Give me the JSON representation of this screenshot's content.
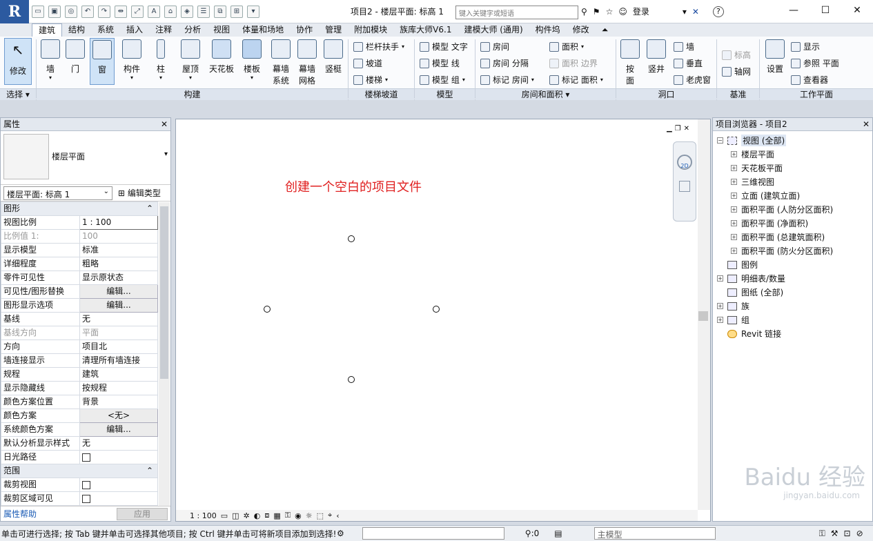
{
  "app": {
    "logo": "R",
    "document_title": "项目2 - 楼层平面: 标高 1"
  },
  "titlebar": {
    "search_placeholder": "键入关键字或短语",
    "login": "登录",
    "help": "?"
  },
  "ribbon_tabs": [
    "建筑",
    "结构",
    "系统",
    "插入",
    "注释",
    "分析",
    "视图",
    "体量和场地",
    "协作",
    "管理",
    "附加模块",
    "族库大师V6.1",
    "建模大师 (通用)",
    "构件坞",
    "修改"
  ],
  "ribbon": {
    "modify": "修改",
    "wall": "墙",
    "door": "门",
    "window": "窗",
    "component": "构件",
    "column": "柱",
    "roof": "屋顶",
    "ceiling": "天花板",
    "floor": "楼板",
    "curtain_system_1": "幕墙",
    "curtain_system_2": "系统",
    "curtain_grid_1": "幕墙",
    "curtain_grid_2": "网格",
    "mullion": "竖梃",
    "railing": "栏杆扶手",
    "ramp": "坡道",
    "stair": "楼梯",
    "model_text": "模型 文字",
    "model_line": "模型 线",
    "model_group": "模型 组",
    "room": "房间",
    "room_sep": "房间 分隔",
    "tag_room": "标记 房间",
    "area": "面积",
    "area_boundary": "面积 边界",
    "tag_area": "标记 面积",
    "by_face_1": "按",
    "by_face_2": "面",
    "shaft": "竖井",
    "wall_opening": "墙",
    "vertical": "垂直",
    "dormer": "老虎窗",
    "level": "标高",
    "grid": "轴网",
    "set": "设置",
    "show": "显示",
    "ref_plane": "参照 平面",
    "viewer": "查看器",
    "panels": [
      "选择 ▾",
      "构建",
      "楼梯坡道",
      "模型",
      "房间和面积 ▾",
      "洞口",
      "基准",
      "工作平面"
    ]
  },
  "properties": {
    "title": "属性",
    "type_name": "楼层平面",
    "instance": "楼层平面: 标高 1",
    "edit_type": "编辑类型",
    "group_graphics": "图形",
    "rows": [
      {
        "label": "视图比例",
        "value": "1 : 100"
      },
      {
        "label": "比例值 1:",
        "value": "100"
      },
      {
        "label": "显示模型",
        "value": "标准"
      },
      {
        "label": "详细程度",
        "value": "粗略"
      },
      {
        "label": "零件可见性",
        "value": "显示原状态"
      },
      {
        "label": "可见性/图形替换",
        "value": "编辑..."
      },
      {
        "label": "图形显示选项",
        "value": "编辑..."
      },
      {
        "label": "基线",
        "value": "无"
      },
      {
        "label": "基线方向",
        "value": "平面"
      },
      {
        "label": "方向",
        "value": "项目北"
      },
      {
        "label": "墙连接显示",
        "value": "清理所有墙连接"
      },
      {
        "label": "规程",
        "value": "建筑"
      },
      {
        "label": "显示隐藏线",
        "value": "按规程"
      },
      {
        "label": "颜色方案位置",
        "value": "背景"
      },
      {
        "label": "颜色方案",
        "value": "<无>"
      },
      {
        "label": "系统颜色方案",
        "value": "编辑..."
      },
      {
        "label": "默认分析显示样式",
        "value": "无"
      },
      {
        "label": "日光路径",
        "value": ""
      }
    ],
    "group_extents": "范围",
    "extent_rows": [
      {
        "label": "裁剪视图",
        "value": ""
      },
      {
        "label": "裁剪区域可见",
        "value": ""
      }
    ],
    "help": "属性帮助",
    "apply": "应用"
  },
  "canvas": {
    "annotation": "创建一个空白的项目文件",
    "scale": "1 : 100",
    "nav_2d": "2D"
  },
  "browser": {
    "title": "项目浏览器 - 项目2",
    "root": "视图 (全部)",
    "view_items": [
      "楼层平面",
      "天花板平面",
      "三维视图",
      "立面 (建筑立面)",
      "面积平面 (人防分区面积)",
      "面积平面 (净面积)",
      "面积平面 (总建筑面积)",
      "面积平面 (防火分区面积)"
    ],
    "other_items": [
      "图例",
      "明细表/数量",
      "图纸 (全部)",
      "族",
      "组",
      "Revit 链接"
    ]
  },
  "status": {
    "message": "单击可进行选择; 按 Tab 键并单击可选择其他项目; 按 Ctrl 键并单击可将新项目添加到选择!",
    "count": ":0",
    "model": "主模型"
  },
  "watermark": {
    "line1": "Baidu 经验",
    "line2": "jingyan.baidu.com"
  }
}
